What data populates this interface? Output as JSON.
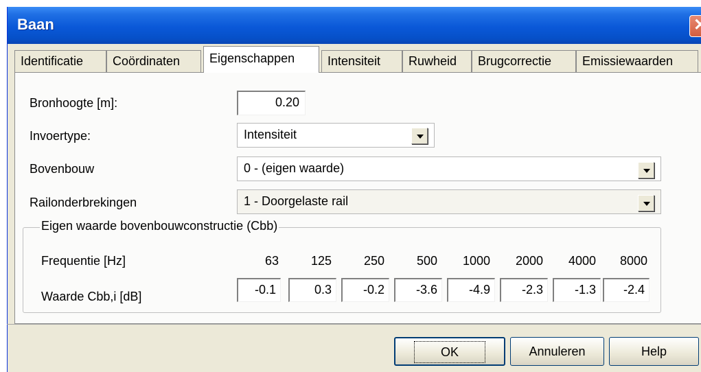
{
  "window": {
    "title": "Baan",
    "close_icon": "close-icon"
  },
  "tabs": [
    {
      "label": "Identificatie",
      "active": false
    },
    {
      "label": "Coördinaten",
      "active": false
    },
    {
      "label": "Eigenschappen",
      "active": true
    },
    {
      "label": "Intensiteit",
      "active": false
    },
    {
      "label": "Ruwheid",
      "active": false
    },
    {
      "label": "Brugcorrectie",
      "active": false
    },
    {
      "label": "Emissiewaarden",
      "active": false
    }
  ],
  "form": {
    "bronhoogte_label": "Bronhoogte [m]:",
    "bronhoogte_value": "0.20",
    "invoertype_label": "Invoertype:",
    "invoertype_value": "Intensiteit",
    "bovenbouw_label": "Bovenbouw",
    "bovenbouw_value": "0 - (eigen waarde)",
    "railonder_label": "Railonderbrekingen",
    "railonder_value": "1 - Doorgelaste rail"
  },
  "group": {
    "title": "Eigen waarde bovenbouwconstructie (Cbb)",
    "freq_label": "Frequentie [Hz]",
    "value_label": "Waarde Cbb,i [dB]",
    "frequencies": [
      "63",
      "125",
      "250",
      "500",
      "1000",
      "2000",
      "4000",
      "8000"
    ],
    "values": [
      "-0.1",
      "0.3",
      "-0.2",
      "-3.6",
      "-4.9",
      "-2.3",
      "-1.3",
      "-2.4"
    ]
  },
  "buttons": {
    "ok": "OK",
    "cancel": "Annuleren",
    "help": "Help"
  }
}
